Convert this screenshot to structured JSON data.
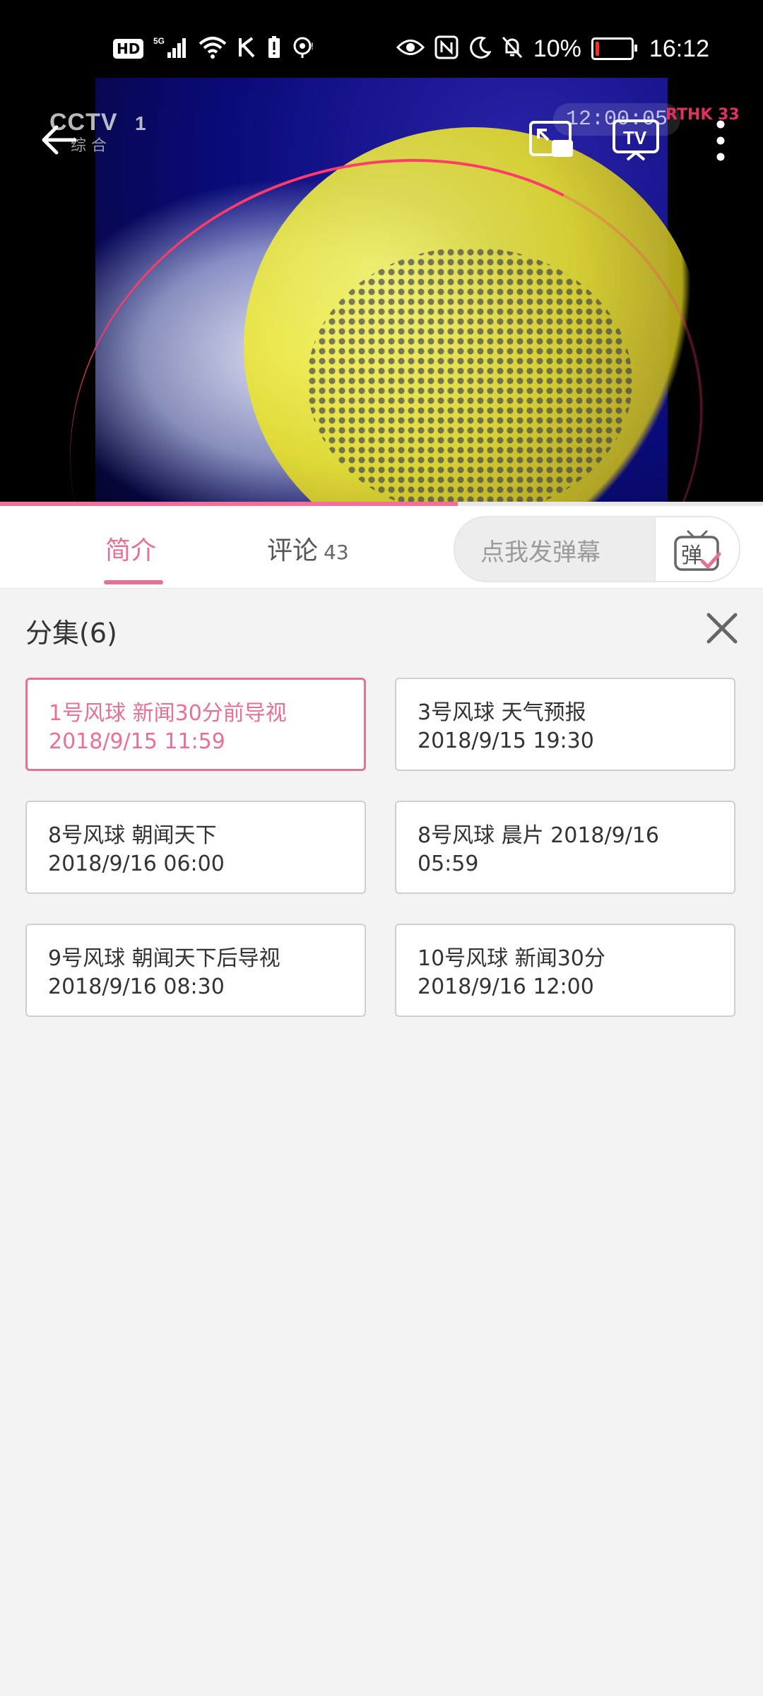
{
  "status_bar": {
    "time": "16:12",
    "battery_percent": "10%",
    "battery_level": 0.1,
    "network": "5G",
    "hd_badge": "HD",
    "icons": [
      "hd-icon",
      "5g-signal-icon",
      "wifi-icon",
      "k-icon",
      "battery-alert-icon",
      "hotspot-icon",
      "eye-icon",
      "nfc-icon",
      "moon-icon",
      "mute-bell-icon",
      "battery-icon"
    ]
  },
  "video": {
    "channel_logo": "CCTV",
    "channel_number": "1",
    "channel_sub": "综 合",
    "clock_overlay": "12:00:05",
    "corner_logo": "RTHK 33",
    "progress": 0.6,
    "controls": [
      "back-arrow-icon",
      "picture-in-picture-icon",
      "tv-cast-icon",
      "more-vert-icon"
    ]
  },
  "tabs": {
    "intro_label": "简介",
    "comments_label": "评论",
    "comments_count": "43",
    "danmaku_placeholder": "点我发弹幕",
    "danmaku_button_glyph": "弹"
  },
  "episodes": {
    "title": "分集(6)",
    "items": [
      {
        "line1": "1号风球 新闻30分前导视",
        "line2": "2018/9/15 11:59",
        "active": true
      },
      {
        "line1": "3号风球 天气预报",
        "line2": "2018/9/15 19:30",
        "active": false
      },
      {
        "line1": "8号风球 朝闻天下",
        "line2": "2018/9/16 06:00",
        "active": false
      },
      {
        "line1": "8号风球 晨片 2018/9/16",
        "line2": "05:59",
        "active": false
      },
      {
        "line1": "9号风球 朝闻天下后导视",
        "line2": "2018/9/16 08:30",
        "active": false
      },
      {
        "line1": "10号风球 新闻30分",
        "line2": "2018/9/16 12:00",
        "active": false
      }
    ]
  },
  "colors": {
    "accent": "#ea6f97",
    "background": "#f3f3f3",
    "card_border": "#cfcfcf"
  }
}
